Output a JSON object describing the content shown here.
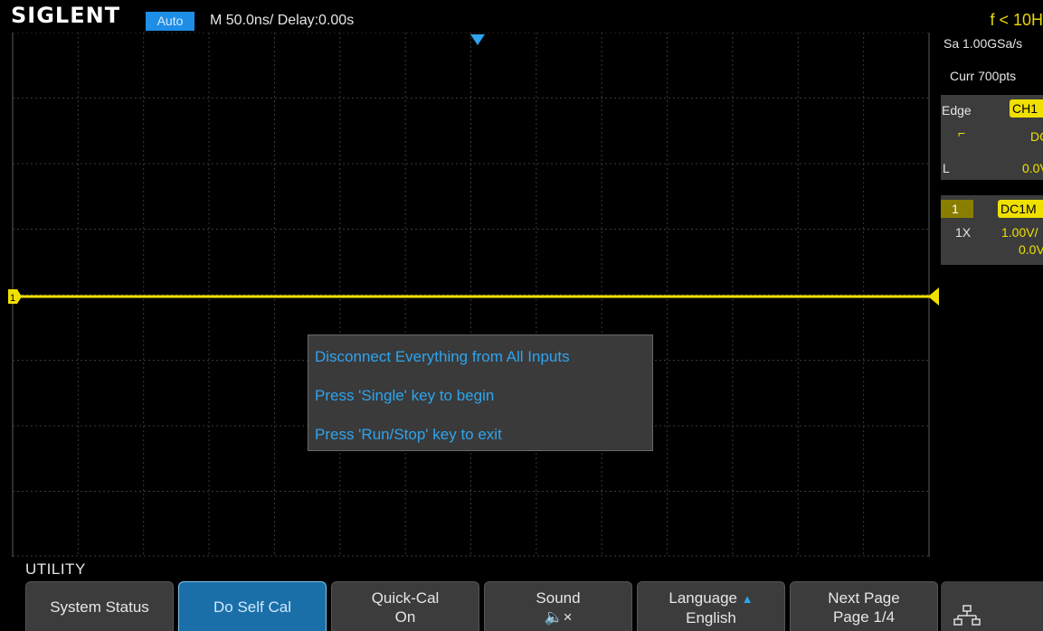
{
  "topbar": {
    "logo": "SIGLENT",
    "mode": "Auto",
    "timebase": "M 50.0ns/  Delay:0.00s",
    "trigger_freq": "f < 10H"
  },
  "acquisition": {
    "sample_rate": "Sa 1.00GSa/s",
    "current_points": "Curr 700pts"
  },
  "trigger": {
    "type": "Edge",
    "source": "CH1",
    "slope_icon": "rising-edge-icon",
    "coupling": "DC",
    "level_label": "L",
    "level": "0.0V"
  },
  "channel1": {
    "number": "1",
    "coupling_impedance": "DC1M",
    "probe": "1X",
    "scale": "1.00V/",
    "offset": "0.0V",
    "marker": "1"
  },
  "dialog": {
    "line1": "Disconnect Everything from All Inputs",
    "line2": "Press 'Single' key to begin",
    "line3": "Press 'Run/Stop' key to exit"
  },
  "menu": {
    "title": "UTILITY",
    "softkeys": [
      {
        "line1": "System Status",
        "line2": ""
      },
      {
        "line1": "Do Self Cal",
        "line2": "",
        "active": true
      },
      {
        "line1": "Quick-Cal",
        "line2": "On"
      },
      {
        "line1": "Sound",
        "line2": "🔈×"
      },
      {
        "line1": "Language",
        "line2": "English"
      },
      {
        "line1": "Next Page",
        "line2": "Page 1/4"
      }
    ],
    "network_icon": "network-icon"
  },
  "colors": {
    "channel1": "#f0e000",
    "accent": "#1e8ee6",
    "dialog_text": "#2ea4ee",
    "panel": "#3c3c3c"
  }
}
